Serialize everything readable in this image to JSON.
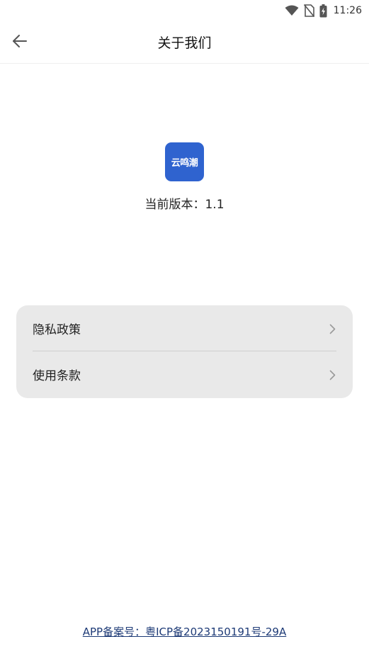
{
  "status_bar": {
    "time": "11:26",
    "icons": [
      "wifi-icon",
      "no-sim-icon",
      "battery-charging-icon"
    ]
  },
  "header": {
    "back_icon": "arrow-left-icon",
    "title": "关于我们"
  },
  "app_info": {
    "logo_text": "云鸣潮",
    "logo_color": "#2f63cf",
    "version_text": "当前版本：1.1"
  },
  "menu": {
    "items": [
      {
        "label": "隐私政策",
        "icon": "chevron-right-icon"
      },
      {
        "label": "使用条款",
        "icon": "chevron-right-icon"
      }
    ]
  },
  "footer": {
    "record_text": "APP备案号：粤ICP备2023150191号-29A"
  }
}
